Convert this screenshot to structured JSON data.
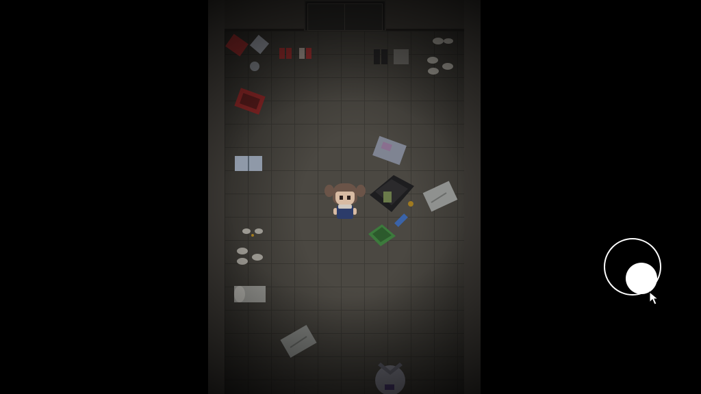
{
  "scene": {
    "name": "Dark room",
    "palette": {
      "background": "#000000",
      "floor": "#4b4842",
      "wall": "#3a3733",
      "joystick": "#ffffff"
    }
  },
  "icons": {
    "player": "girl-with-pigtails-sprite",
    "joystick": "virtual-joystick",
    "cursor": "mouse-pointer-icon"
  }
}
